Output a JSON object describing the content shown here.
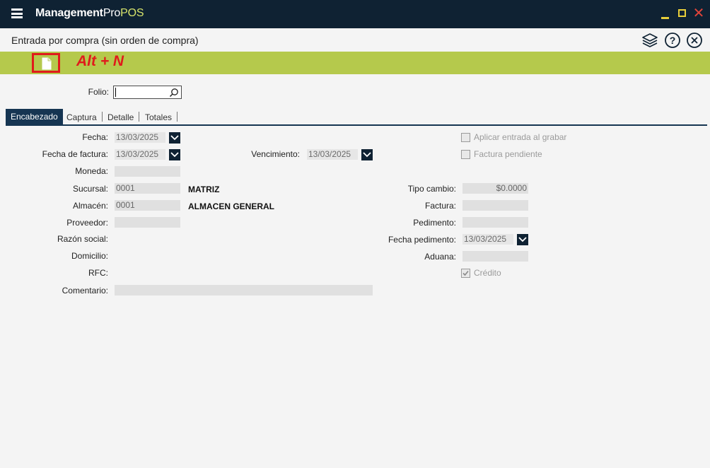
{
  "window": {
    "app_name_bold": "Management",
    "app_name_regular": "Pro",
    "app_name_accent": "POS",
    "minimize_icon": "minimize-icon",
    "maximize_icon": "maximize-icon",
    "close_icon": "close-window-icon"
  },
  "header": {
    "form_title": "Entrada por compra (sin orden de compra)",
    "icons": [
      "layers-icon",
      "help-icon",
      "close-circle-icon"
    ]
  },
  "toolbar": {
    "new_icon": "new-document-icon",
    "shortcut_hint": "Alt + N"
  },
  "folio": {
    "label": "Folio:",
    "value": ""
  },
  "tabs": [
    "Encabezado",
    "Captura",
    "Detalle",
    "Totales"
  ],
  "form": {
    "fecha": {
      "label": "Fecha:",
      "value": "13/03/2025"
    },
    "fecha_factura": {
      "label": "Fecha de factura:",
      "value": "13/03/2025"
    },
    "vencimiento": {
      "label": "Vencimiento:",
      "value": "13/03/2025"
    },
    "moneda": {
      "label": "Moneda:",
      "value": ""
    },
    "sucursal": {
      "label": "Sucursal:",
      "code": "0001",
      "name": "MATRIZ"
    },
    "almacen": {
      "label": "Almacén:",
      "code": "0001",
      "name": "ALMACEN GENERAL"
    },
    "proveedor": {
      "label": "Proveedor:",
      "value": ""
    },
    "razon_social": {
      "label": "Razón social:",
      "value": ""
    },
    "domicilio": {
      "label": "Domicilio:",
      "value": ""
    },
    "rfc": {
      "label": "RFC:",
      "value": ""
    },
    "comentario": {
      "label": "Comentario:",
      "value": ""
    },
    "aplicar_entrada": {
      "label": "Aplicar entrada al grabar",
      "checked": false
    },
    "factura_pendiente": {
      "label": "Factura pendiente",
      "checked": false
    },
    "tipo_cambio": {
      "label": "Tipo cambio:",
      "value": "$0.0000"
    },
    "factura": {
      "label": "Factura:",
      "value": ""
    },
    "pedimento": {
      "label": "Pedimento:",
      "value": ""
    },
    "fecha_pedimento": {
      "label": "Fecha pedimento:",
      "value": "13/03/2025"
    },
    "aduana": {
      "label": "Aduana:",
      "value": ""
    },
    "credito": {
      "label": "Crédito",
      "checked": true
    }
  },
  "colors": {
    "titlebar": "#0f2233",
    "toolbar": "#b5c94c",
    "accent_red": "#e01b1b",
    "tab_active": "#163552"
  }
}
